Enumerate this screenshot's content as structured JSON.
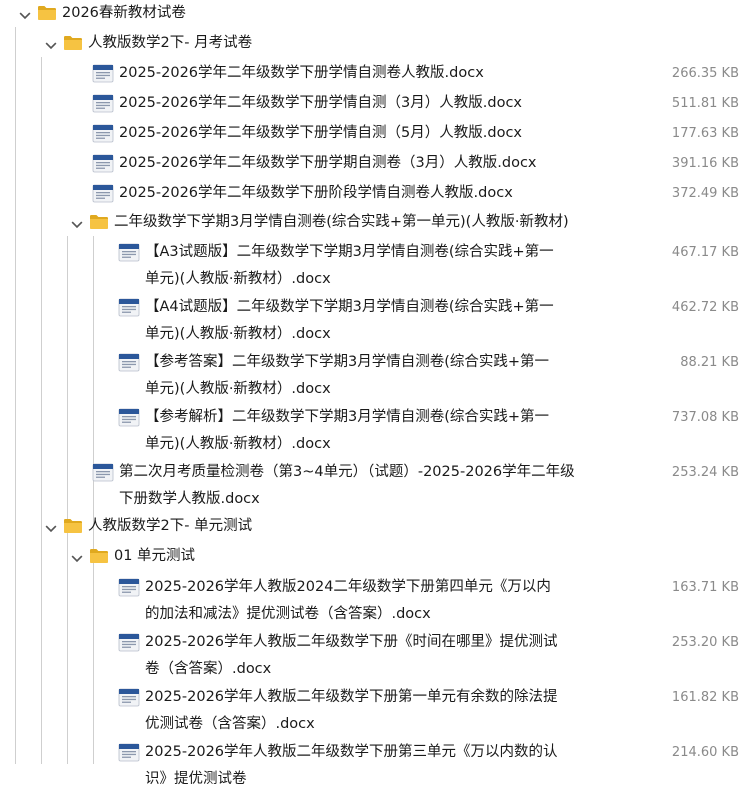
{
  "tree": [
    {
      "type": "folder",
      "depth": 0,
      "name": "2026春新教材试卷"
    },
    {
      "type": "folder",
      "depth": 1,
      "name": "人教版数学2下- 月考试卷"
    },
    {
      "type": "file",
      "depth": 2,
      "name": "2025-2026学年二年级数学下册学情自测卷人教版.docx",
      "size": "266.35 KB"
    },
    {
      "type": "file",
      "depth": 2,
      "name": "2025-2026学年二年级数学下册学情自测（3月）人教版.docx",
      "size": "511.81 KB"
    },
    {
      "type": "file",
      "depth": 2,
      "name": "2025-2026学年二年级数学下册学情自测（5月）人教版.docx",
      "size": "177.63 KB"
    },
    {
      "type": "file",
      "depth": 2,
      "name": "2025-2026学年二年级数学下册学期自测卷（3月）人教版.docx",
      "size": "391.16 KB"
    },
    {
      "type": "file",
      "depth": 2,
      "name": "2025-2026学年二年级数学下册阶段学情自测卷人教版.docx",
      "size": "372.49 KB"
    },
    {
      "type": "folder",
      "depth": 2,
      "name": "二年级数学下学期3月学情自测卷(综合实践+第一单元)(人教版·新教材)"
    },
    {
      "type": "file",
      "depth": 3,
      "name": "【A3试题版】二年级数学下学期3月学情自测卷(综合实践+第一单元)(人教版·新教材）.docx",
      "size": "467.17 KB"
    },
    {
      "type": "file",
      "depth": 3,
      "name": "【A4试题版】二年级数学下学期3月学情自测卷(综合实践+第一单元)(人教版·新教材）.docx",
      "size": "462.72 KB"
    },
    {
      "type": "file",
      "depth": 3,
      "name": "【参考答案】二年级数学下学期3月学情自测卷(综合实践+第一单元)(人教版·新教材）.docx",
      "size": "88.21 KB"
    },
    {
      "type": "file",
      "depth": 3,
      "name": "【参考解析】二年级数学下学期3月学情自测卷(综合实践+第一单元)(人教版·新教材）.docx",
      "size": "737.08 KB"
    },
    {
      "type": "file",
      "depth": 2,
      "name": "第二次月考质量检测卷（第3~4单元）（试题）-2025-2026学年二年级下册数学人教版.docx",
      "size": "253.24 KB"
    },
    {
      "type": "folder",
      "depth": 1,
      "name": "人教版数学2下- 单元测试"
    },
    {
      "type": "folder",
      "depth": 2,
      "name": "01 单元测试"
    },
    {
      "type": "file",
      "depth": 3,
      "name": "2025-2026学年人教版2024二年级数学下册第四单元《万以内的加法和减法》提优测试卷（含答案）.docx",
      "size": "163.71 KB"
    },
    {
      "type": "file",
      "depth": 3,
      "name": "2025-2026学年人教版二年级数学下册《时间在哪里》提优测试卷（含答案）.docx",
      "size": "253.20 KB"
    },
    {
      "type": "file",
      "depth": 3,
      "name": "2025-2026学年人教版二年级数学下册第一单元有余数的除法提优测试卷（含答案）.docx",
      "size": "161.82 KB"
    },
    {
      "type": "file",
      "depth": 3,
      "name": "2025-2026学年人教版二年级数学下册第三单元《万以内数的认识》提优测试卷",
      "size": "214.60 KB"
    }
  ],
  "icons": {
    "folder": "folder-icon",
    "file": "word-document-icon",
    "expand": "chevron-down-icon"
  },
  "colors": {
    "folder": "#F6C342",
    "folder_dark": "#E0A91F",
    "doc_blue": "#2B579A",
    "size_text": "#8a8a8a",
    "guide": "#cfcfcf"
  }
}
